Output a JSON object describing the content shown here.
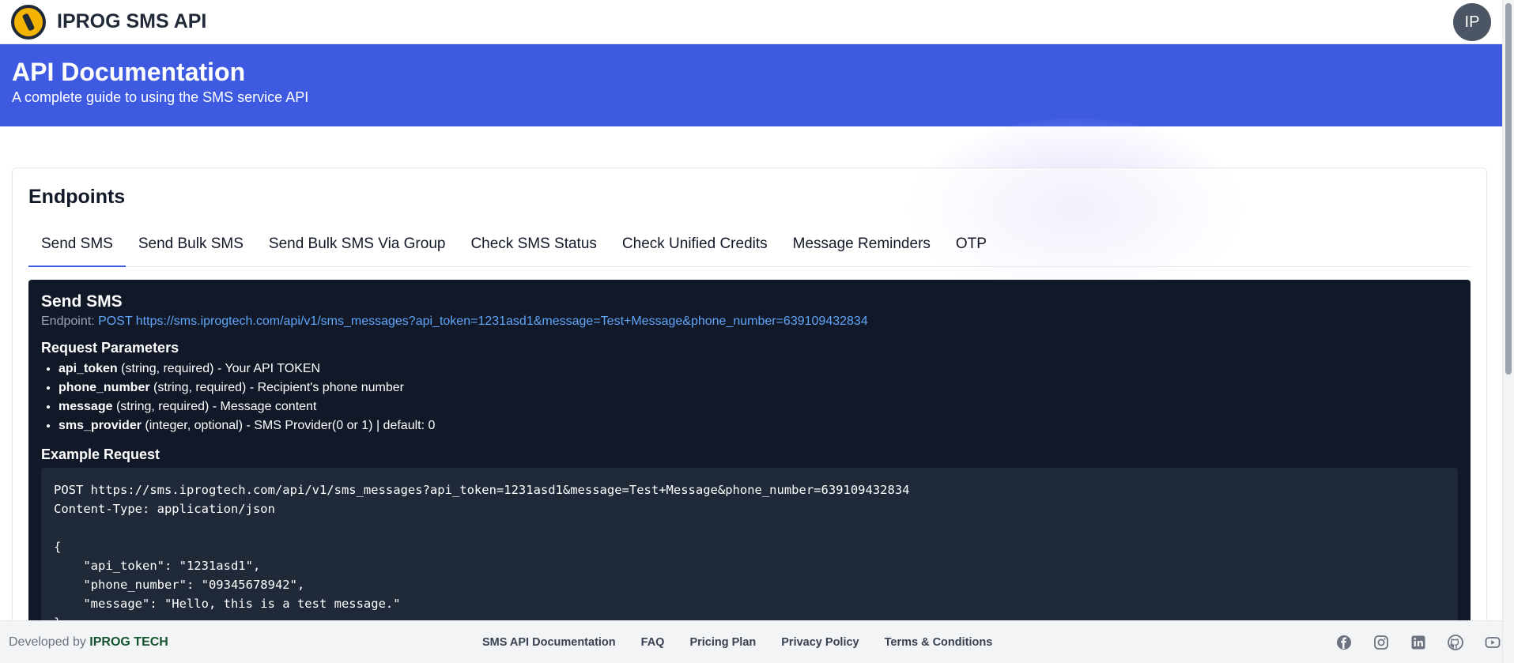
{
  "header": {
    "brand": "IPROG SMS API",
    "avatar": "IP"
  },
  "hero": {
    "title": "API Documentation",
    "subtitle": "A complete guide to using the SMS service API"
  },
  "endpoints": {
    "title": "Endpoints",
    "tabs": [
      "Send SMS",
      "Send Bulk SMS",
      "Send Bulk SMS Via Group",
      "Check SMS Status",
      "Check Unified Credits",
      "Message Reminders",
      "OTP"
    ]
  },
  "panel": {
    "title": "Send SMS",
    "endpoint_label": "Endpoint:",
    "endpoint_value": "POST https://sms.iprogtech.com/api/v1/sms_messages?api_token=1231asd1&message=Test+Message&phone_number=639109432834",
    "params_title": "Request Parameters",
    "params": [
      {
        "name": "api_token",
        "desc": " (string, required) - Your API TOKEN"
      },
      {
        "name": "phone_number",
        "desc": " (string, required) - Recipient's phone number"
      },
      {
        "name": "message",
        "desc": " (string, required) - Message content"
      },
      {
        "name": "sms_provider",
        "desc": " (integer, optional) - SMS Provider(0 or 1) | default: 0"
      }
    ],
    "example_title": "Example Request",
    "code": "POST https://sms.iprogtech.com/api/v1/sms_messages?api_token=1231asd1&message=Test+Message&phone_number=639109432834\nContent-Type: application/json\n\n{\n    \"api_token\": \"1231asd1\",\n    \"phone_number\": \"09345678942\",\n    \"message\": \"Hello, this is a test message.\"\n}"
  },
  "footer": {
    "developed_by": "Developed by",
    "company": "IPROG TECH",
    "links": [
      "SMS API Documentation",
      "FAQ",
      "Pricing Plan",
      "Privacy Policy",
      "Terms & Conditions"
    ],
    "social_icons": [
      "facebook-icon",
      "instagram-icon",
      "linkedin-icon",
      "github-icon",
      "youtube-icon"
    ]
  },
  "colors": {
    "accent": "#3d5ae1",
    "panel_bg": "#111827",
    "link": "#60a5fa"
  }
}
